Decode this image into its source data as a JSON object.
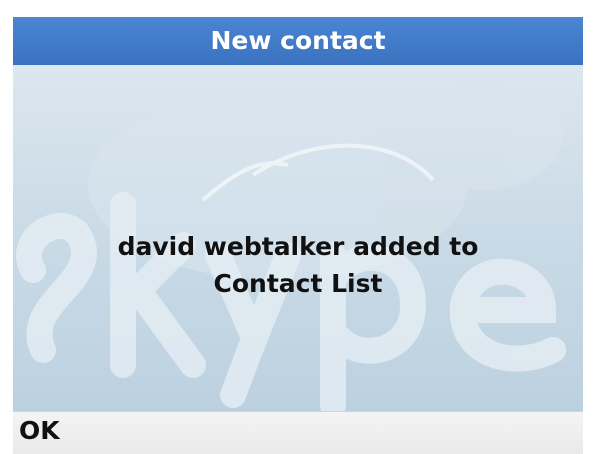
{
  "window": {
    "title": "New contact"
  },
  "message": {
    "line1": "david webtalker added to",
    "line2": "Contact List"
  },
  "softkeys": {
    "left_label": "OK"
  },
  "colors": {
    "titlebar": "#3f7bc8",
    "content_background": "#cbdbe7",
    "softkey_bar": "#efefef"
  },
  "icons": {
    "watermark": "skype-logo-watermark"
  }
}
